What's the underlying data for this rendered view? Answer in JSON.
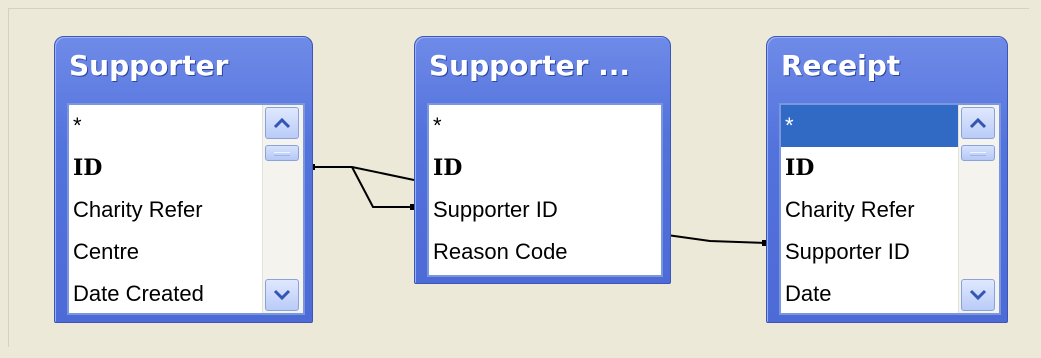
{
  "tables": [
    {
      "id": "supporter",
      "title": "Supporter",
      "fields": [
        {
          "label": "*",
          "key": false,
          "selected": false
        },
        {
          "label": "ID",
          "key": true,
          "selected": false
        },
        {
          "label": "Charity Refer",
          "key": false,
          "selected": false
        },
        {
          "label": "Centre",
          "key": false,
          "selected": false
        },
        {
          "label": "Date Created",
          "key": false,
          "selected": false
        }
      ],
      "has_scrollbar": true
    },
    {
      "id": "supporter-reason",
      "title": "Supporter ...",
      "fields": [
        {
          "label": "*",
          "key": false,
          "selected": false
        },
        {
          "label": "ID",
          "key": true,
          "selected": false
        },
        {
          "label": "Supporter ID",
          "key": false,
          "selected": false
        },
        {
          "label": "Reason Code",
          "key": false,
          "selected": false
        }
      ],
      "has_scrollbar": false
    },
    {
      "id": "receipt",
      "title": "Receipt",
      "fields": [
        {
          "label": "*",
          "key": false,
          "selected": true
        },
        {
          "label": "ID",
          "key": true,
          "selected": false
        },
        {
          "label": "Charity Refer",
          "key": false,
          "selected": false
        },
        {
          "label": "Supporter ID",
          "key": false,
          "selected": false
        },
        {
          "label": "Date",
          "key": false,
          "selected": false
        }
      ],
      "has_scrollbar": true
    }
  ],
  "relationships": [
    {
      "from": "Supporter.ID",
      "to": "Supporter ....Supporter ID"
    },
    {
      "from": "Supporter ....Reason Code",
      "to": "Receipt.Supporter ID"
    }
  ],
  "icons": {
    "scroll_up": "chevron-up-icon",
    "scroll_down": "chevron-down-icon"
  },
  "colors": {
    "background": "#ECE9D8",
    "title_bar": "#5272DC",
    "selection": "#316AC5"
  }
}
